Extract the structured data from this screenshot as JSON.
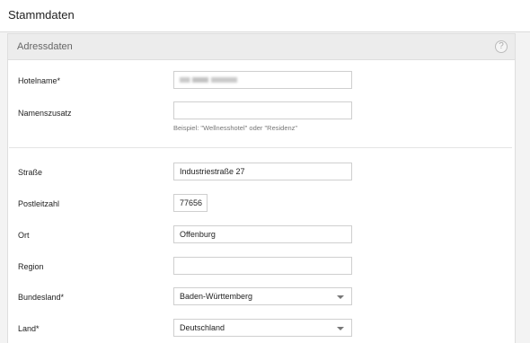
{
  "page": {
    "title": "Stammdaten"
  },
  "panel": {
    "title": "Adressdaten",
    "help_icon": "question-circle-icon",
    "help_glyph": "?"
  },
  "fields": {
    "hotelname": {
      "label": "Hotelname*",
      "value": ""
    },
    "namenszusatz": {
      "label": "Namenszusatz",
      "value": "",
      "hint": "Beispiel: \"Wellnesshotel\" oder \"Residenz\""
    },
    "strasse": {
      "label": "Straße",
      "value": "Industriestraße 27"
    },
    "postleitzahl": {
      "label": "Postleitzahl",
      "value": "77656"
    },
    "ort": {
      "label": "Ort",
      "value": "Offenburg"
    },
    "region": {
      "label": "Region",
      "value": ""
    },
    "bundesland": {
      "label": "Bundesland*",
      "value": "Baden-Württemberg"
    },
    "land": {
      "label": "Land*",
      "value": "Deutschland"
    }
  }
}
